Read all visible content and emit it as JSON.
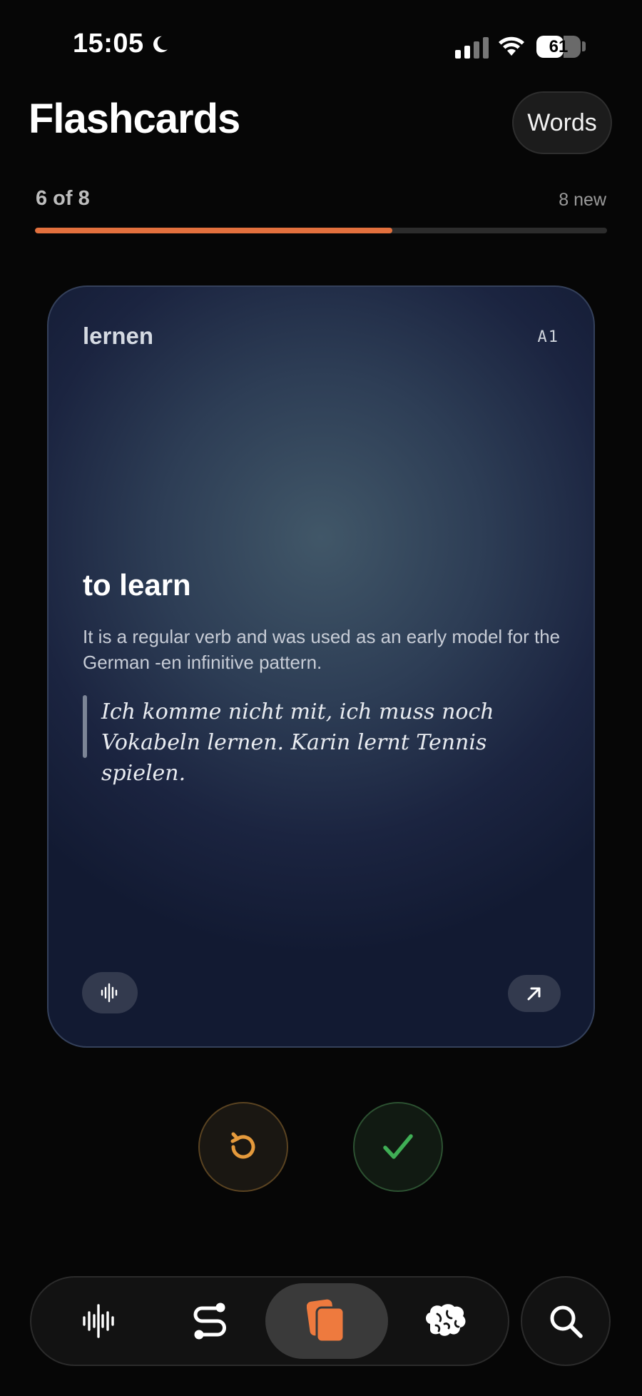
{
  "status_bar": {
    "time": "15:05",
    "battery": "61",
    "battery_level": 0.61,
    "icons": [
      "moon-icon",
      "cellular-signal-icon",
      "wifi-icon",
      "battery-icon"
    ]
  },
  "header": {
    "title": "Flashcards",
    "words_button": "Words"
  },
  "progress": {
    "label": "6 of 8",
    "new_label": "8 new",
    "fraction": 0.625,
    "color": "#e2703d"
  },
  "card": {
    "word": "lernen",
    "level": "A1",
    "translation": "to learn",
    "note": "It is a regular verb and was used as an early model for the German -en infinitive pattern.",
    "example": "Ich komme nicht mit, ich muss noch Vokabeln lernen. Karin lernt Tennis spielen.",
    "icons": [
      "audio-waveform-icon",
      "expand-arrow-icon"
    ]
  },
  "actions": {
    "again_icon": "rotate-ccw-icon",
    "again_color": "#e59a3c",
    "know_icon": "checkmark-icon",
    "know_color": "#3fae55"
  },
  "bottom_nav": {
    "items": [
      {
        "icon": "waveform-icon",
        "active": false
      },
      {
        "icon": "path-icon",
        "active": false
      },
      {
        "icon": "cards-icon",
        "active": true
      },
      {
        "icon": "brain-icon",
        "active": false
      }
    ],
    "search_icon": "search-icon",
    "accent": "#ee7a3e"
  }
}
